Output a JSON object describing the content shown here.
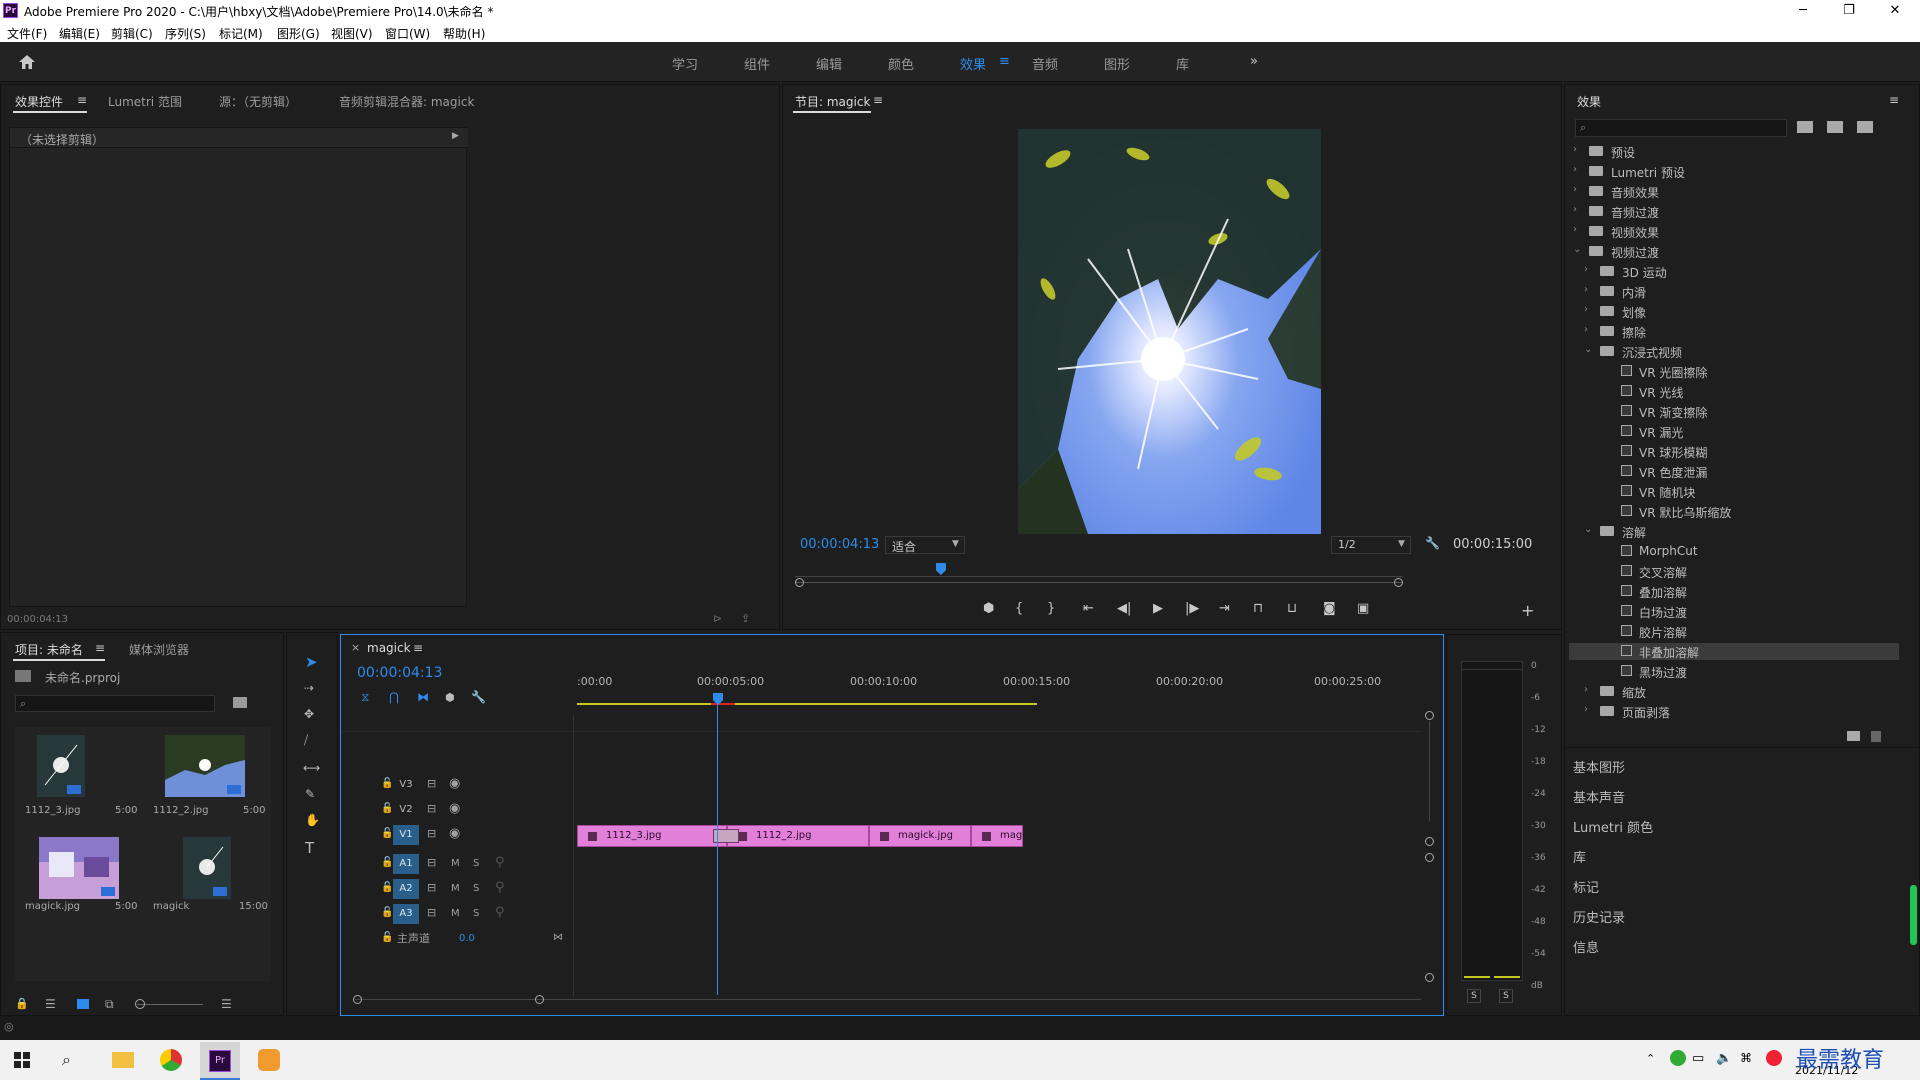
{
  "window": {
    "title": "Adobe Premiere Pro 2020 - C:\\用户\\hbxy\\文档\\Adobe\\Premiere Pro\\14.0\\未命名 *",
    "app_badge": "Pr"
  },
  "menu": [
    "文件(F)",
    "编辑(E)",
    "剪辑(C)",
    "序列(S)",
    "标记(M)",
    "图形(G)",
    "视图(V)",
    "窗口(W)",
    "帮助(H)"
  ],
  "workspaces": [
    "学习",
    "组件",
    "编辑",
    "颜色",
    "效果",
    "音频",
    "图形",
    "库"
  ],
  "workspace_active": "效果",
  "source_panel": {
    "tabs": [
      "效果控件",
      "Lumetri 范围",
      "源：（无剪辑）",
      "音频剪辑混合器: magick"
    ],
    "clip_label": "（未选择剪辑）",
    "timecode": "00:00:04:13"
  },
  "program_monitor": {
    "title": "节目: magick",
    "timecode": "00:00:04:13",
    "fit": "适合",
    "resolution": "1/2",
    "duration": "00:00:15:00",
    "playhead_progress": 0.24
  },
  "effects_panel": {
    "title": "效果",
    "items": [
      {
        "label": "预设",
        "level": 0,
        "kind": "folder",
        "expanded": false
      },
      {
        "label": "Lumetri 预设",
        "level": 0,
        "kind": "folder",
        "expanded": false
      },
      {
        "label": "音频效果",
        "level": 0,
        "kind": "folder",
        "expanded": false
      },
      {
        "label": "音频过渡",
        "level": 0,
        "kind": "folder",
        "expanded": false
      },
      {
        "label": "视频效果",
        "level": 0,
        "kind": "folder",
        "expanded": false
      },
      {
        "label": "视频过渡",
        "level": 0,
        "kind": "folder",
        "expanded": true
      },
      {
        "label": "3D 运动",
        "level": 1,
        "kind": "folder",
        "expanded": false
      },
      {
        "label": "内滑",
        "level": 1,
        "kind": "folder",
        "expanded": false
      },
      {
        "label": "划像",
        "level": 1,
        "kind": "folder",
        "expanded": false
      },
      {
        "label": "擦除",
        "level": 1,
        "kind": "folder",
        "expanded": false
      },
      {
        "label": "沉浸式视频",
        "level": 1,
        "kind": "folder",
        "expanded": true
      },
      {
        "label": "VR 光圈擦除",
        "level": 2,
        "kind": "fx"
      },
      {
        "label": "VR 光线",
        "level": 2,
        "kind": "fx"
      },
      {
        "label": "VR 渐变擦除",
        "level": 2,
        "kind": "fx"
      },
      {
        "label": "VR 漏光",
        "level": 2,
        "kind": "fx"
      },
      {
        "label": "VR 球形模糊",
        "level": 2,
        "kind": "fx"
      },
      {
        "label": "VR 色度泄漏",
        "level": 2,
        "kind": "fx"
      },
      {
        "label": "VR 随机块",
        "level": 2,
        "kind": "fx"
      },
      {
        "label": "VR 默比乌斯缩放",
        "level": 2,
        "kind": "fx"
      },
      {
        "label": "溶解",
        "level": 1,
        "kind": "folder",
        "expanded": true
      },
      {
        "label": "MorphCut",
        "level": 2,
        "kind": "fx"
      },
      {
        "label": "交叉溶解",
        "level": 2,
        "kind": "fx"
      },
      {
        "label": "叠加溶解",
        "level": 2,
        "kind": "fx"
      },
      {
        "label": "白场过渡",
        "level": 2,
        "kind": "fx"
      },
      {
        "label": "胶片溶解",
        "level": 2,
        "kind": "fx"
      },
      {
        "label": "非叠加溶解",
        "level": 2,
        "kind": "fx",
        "selected": true
      },
      {
        "label": "黑场过渡",
        "level": 2,
        "kind": "fx"
      },
      {
        "label": "缩放",
        "level": 1,
        "kind": "folder",
        "expanded": false
      },
      {
        "label": "页面剥落",
        "level": 1,
        "kind": "folder",
        "expanded": false
      }
    ],
    "collapsed_panels": [
      "基本图形",
      "基本声音",
      "Lumetri 颜色",
      "库",
      "标记",
      "历史记录",
      "信息"
    ]
  },
  "project_panel": {
    "tabs": [
      "项目: 未命名",
      "媒体浏览器"
    ],
    "project_file": "未命名.prproj",
    "bins": [
      {
        "name": "1112_3.jpg",
        "duration": "5:00"
      },
      {
        "name": "1112_2.jpg",
        "duration": "5:00"
      },
      {
        "name": "magick.jpg",
        "duration": "5:00"
      },
      {
        "name": "magick",
        "duration": "15:00"
      }
    ]
  },
  "timeline": {
    "sequence": "magick",
    "timecode": "00:00:04:13",
    "ruler": [
      ":00:00",
      "00:00:05:00",
      "00:00:10:00",
      "00:00:15:00",
      "00:00:20:00",
      "00:00:25:00"
    ],
    "video_tracks": [
      "V3",
      "V2",
      "V1"
    ],
    "audio_tracks": [
      "A1",
      "A2",
      "A3"
    ],
    "master_label": "主声道",
    "master_value": "0.0",
    "mute_label": "M",
    "solo_label": "S",
    "clips": [
      "1112_3.jpg",
      "1112_2.jpg",
      "magick.jpg",
      "mag"
    ]
  },
  "meter": {
    "scale": [
      "0",
      "-6",
      "-12",
      "-18",
      "-24",
      "-30",
      "-36",
      "-42",
      "-48",
      "-54",
      "dB"
    ],
    "solo": [
      "S",
      "S"
    ]
  },
  "taskbar": {
    "date": "2021/11/12",
    "watermark": "最需教育"
  },
  "colors": {
    "accent": "#2d8ceb",
    "clip": "#e27fd9",
    "track_on": "#2a5f8c"
  }
}
